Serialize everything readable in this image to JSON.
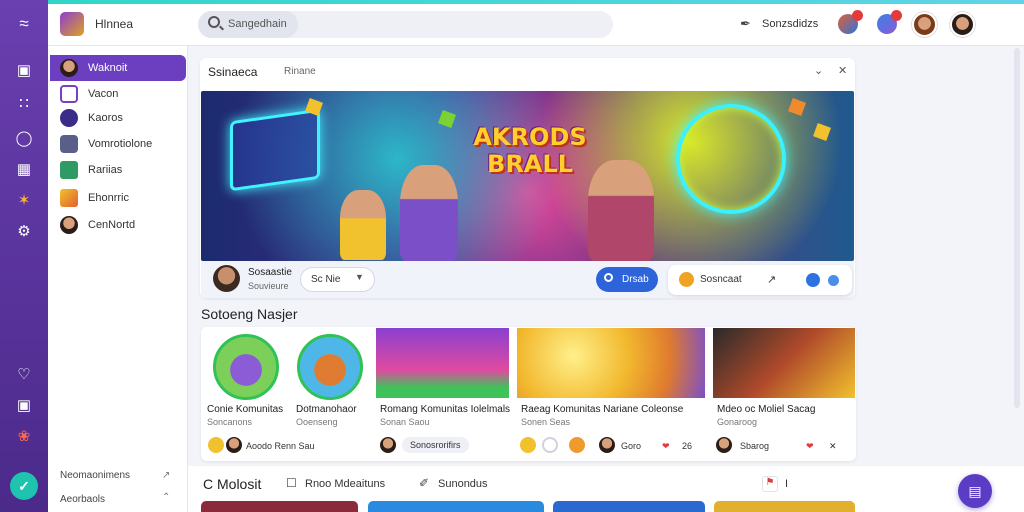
{
  "app": {
    "title": "Hlnnea"
  },
  "search": {
    "text": "Sangedhain"
  },
  "topbar": {
    "tool_label": "Sonzsdidzs"
  },
  "sidebar": {
    "items": [
      {
        "label": "Waknoit"
      },
      {
        "label": "Vacon"
      },
      {
        "label": "Kaoros"
      },
      {
        "label": "Vomrotiolone"
      },
      {
        "label": "Rariias"
      },
      {
        "label": "Ehonrric"
      },
      {
        "label": "CenNortd"
      }
    ],
    "footer": [
      {
        "label": "Neomaonimens"
      },
      {
        "label": "Aeorbaols"
      }
    ]
  },
  "main": {
    "tabs": [
      {
        "label": "Ssinaeca"
      },
      {
        "label": "Rinane"
      }
    ],
    "hero": {
      "title_line1": "AKRODS",
      "title_line2": "BRALL"
    },
    "creator": {
      "name": "Sosaastie",
      "sub": "Souvieure"
    },
    "select": {
      "value": "Sc Nie"
    },
    "primary_btn": {
      "label": "Drsab"
    },
    "group": {
      "label": "Sosncaat"
    }
  },
  "section": {
    "title": "Sotoeng Nasjer"
  },
  "cards": [
    {
      "title": "Conie Komunitas",
      "title2": "Dotmanohaor",
      "sub": "Soncanons",
      "sub2": "Ooenseng",
      "foot": "Aoodo Renn Sau"
    },
    {
      "title": "Romang Komunitas Iolelmals",
      "sub": "Sonan Saou",
      "foot": "Sonosrorifirs"
    },
    {
      "title": "Raeag Komunitas Nariane Coleonse",
      "sub": "Sonen Seas",
      "foot": "Goro",
      "foot_num": "26"
    },
    {
      "title": "Mdeo oc Moliel Sacag",
      "sub": "Gonaroog",
      "foot": "Sbarog"
    }
  ],
  "bottom": {
    "title": "C Molosit",
    "links": [
      {
        "label": "Rnoo Mdeaituns"
      },
      {
        "label": "Sunondus"
      }
    ],
    "extra": "I"
  },
  "colors": {
    "accent": "#6b3fc0",
    "rail": "#4b2a8a",
    "primary_btn": "#2d64d9",
    "teal": "#1fc4b0"
  }
}
